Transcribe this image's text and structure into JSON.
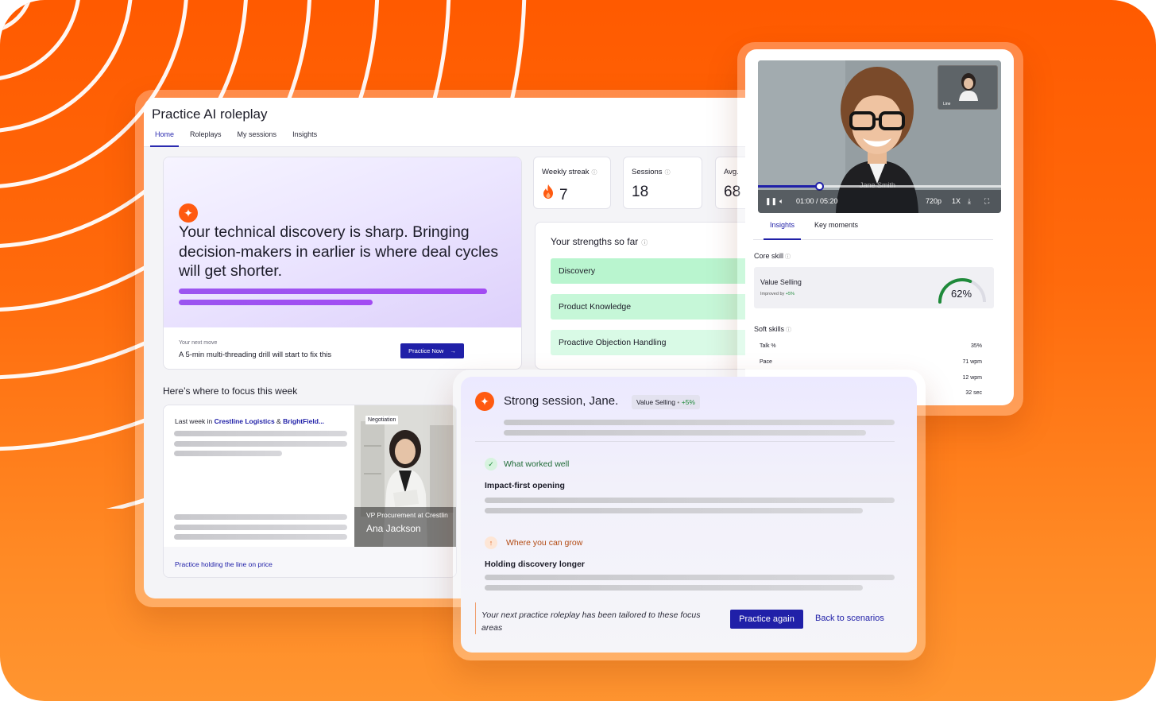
{
  "main": {
    "title": "Practice AI roleplay",
    "tabs": [
      "Home",
      "Roleplays",
      "My sessions",
      "Insights"
    ],
    "insight": {
      "text": "Your technical discovery is sharp. Bringing decision-makers in earlier is where deal cycles will get shorter.",
      "next_label": "Your next move",
      "next_text": "A 5-min multi-threading drill will start to fix this",
      "button": "Practice Now"
    },
    "stats": [
      {
        "label": "Weekly streak",
        "value": "7"
      },
      {
        "label": "Sessions",
        "value": "18"
      },
      {
        "label": "Avg.",
        "value": "68"
      }
    ],
    "strengths": {
      "title": "Your strengths so far",
      "items": [
        "Discovery",
        "Product Knowledge",
        "Proactive Objection Handling"
      ]
    },
    "focus": {
      "title": "Here’s where to focus this week",
      "last_week_prefix": "Last week in ",
      "company_1": "Crestline Logistics",
      "amp": " & ",
      "company_2": "BrightField...",
      "link": "Practice holding the line on price",
      "persona_tag": "Negotiation",
      "persona_role": "VP Procurement at Crestlin",
      "persona_name": "Ana Jackson"
    }
  },
  "video": {
    "caption": "Jane Smith",
    "pip_label": "Line",
    "time": "01:00 / 05:20",
    "progress": 0.25,
    "quality": "720p",
    "speed": "1X",
    "tabs": [
      "Insights",
      "Key moments"
    ],
    "core_label": "Core skill",
    "core_name": "Value Selling",
    "core_sub_prefix": "Improved by ",
    "core_sub_value": "+5%",
    "core_percent": "62%",
    "core_fraction": 0.62,
    "soft_label": "Soft skills",
    "soft": [
      {
        "name": "Talk %",
        "value": "35%"
      },
      {
        "name": "Pace",
        "value": "71 wpm"
      },
      {
        "name": "",
        "value": "12 wpm"
      },
      {
        "name": "",
        "value": "32 sec"
      }
    ]
  },
  "session": {
    "title": "Strong session, Jane.",
    "chip_skill": "Value Selling",
    "chip_sep": " • ",
    "chip_delta": "+5%",
    "worked_head": "What worked well",
    "worked_item": "Impact-first opening",
    "grow_head": "Where you can grow",
    "grow_item": "Holding discovery longer",
    "note": "Your next practice roleplay has been tailored to these focus areas",
    "again_button": "Practice again",
    "back_link": "Back to scenarios"
  },
  "colors": {
    "accent": "#2020a8",
    "orange": "#ff5a00",
    "positive": "#1f8a3a",
    "strength_bg": "#b9f5cf"
  }
}
